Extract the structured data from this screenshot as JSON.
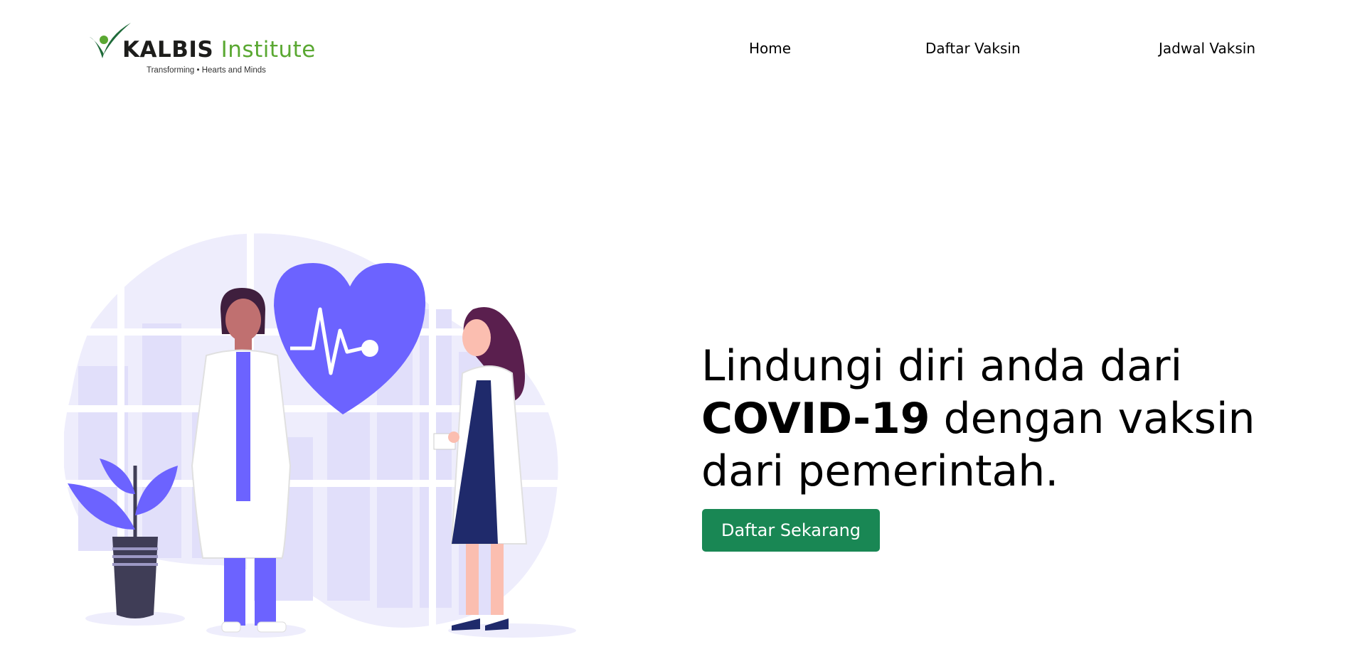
{
  "header": {
    "logo": {
      "brand": "KALBIS",
      "institute": "Institute",
      "tagline": "Transforming • Hearts and Minds"
    },
    "nav": {
      "home": "Home",
      "daftar_vaksin": "Daftar Vaksin",
      "jadwal_vaksin": "Jadwal Vaksin"
    }
  },
  "hero": {
    "heading_line1": "Lindungi diri anda dari",
    "heading_bold": "COVID-19",
    "heading_rest": " dengan vaksin dari pemerintah.",
    "cta_label": "Daftar Sekarang"
  },
  "colors": {
    "accent": "#6c63ff",
    "cta": "#198754",
    "brand_green": "#5aa832"
  },
  "icons": [
    "heart-pulse-icon",
    "doctor-male-illustration",
    "doctor-female-illustration",
    "plant-illustration"
  ]
}
